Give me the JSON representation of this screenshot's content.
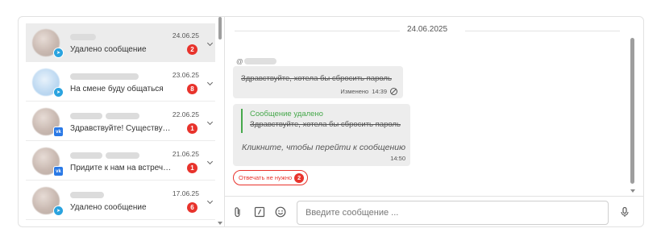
{
  "conversations": [
    {
      "date": "24.06.25",
      "message": "Удалено сообщение",
      "unread": "2",
      "source": "telegram",
      "active": true
    },
    {
      "date": "23.06.25",
      "message": "На смене буду общаться",
      "unread": "8",
      "source": "telegram",
      "active": false
    },
    {
      "date": "22.06.25",
      "message": "Здравствуйте! Существует...",
      "unread": "1",
      "source": "vk",
      "active": false
    },
    {
      "date": "21.06.25",
      "message": "Придите к нам на встречу!...",
      "unread": "1",
      "source": "vk",
      "active": false
    },
    {
      "date": "17.06.25",
      "message": "Удалено сообщение",
      "unread": "6",
      "source": "telegram",
      "active": false
    }
  ],
  "chat": {
    "date_separator": "24.06.2025",
    "sender_prefix": "@",
    "message1": {
      "text": "Здравствуйте, хотела бы сбросить пароль",
      "edited_label": "Изменено",
      "time": "14:39"
    },
    "message2": {
      "quote_title": "Сообщение удалено",
      "quote_text": "Здравствуйте, хотела бы сбросить пароль",
      "link_text": "Кликните, чтобы перейти к сообщению",
      "time": "14:50"
    },
    "no_reply_chip": {
      "label": "Отвечать не нужно",
      "count": "2"
    }
  },
  "composer": {
    "placeholder": "Введите сообщение ..."
  },
  "colors": {
    "unread_badge": "#e8332c",
    "telegram": "#2aa3df",
    "vk": "#2a79e6",
    "quote_green": "#46a84b"
  },
  "icons": [
    "paperclip-icon",
    "template-icon",
    "emoji-icon",
    "microphone-icon",
    "no-entry-icon",
    "chevron-down-icon"
  ]
}
